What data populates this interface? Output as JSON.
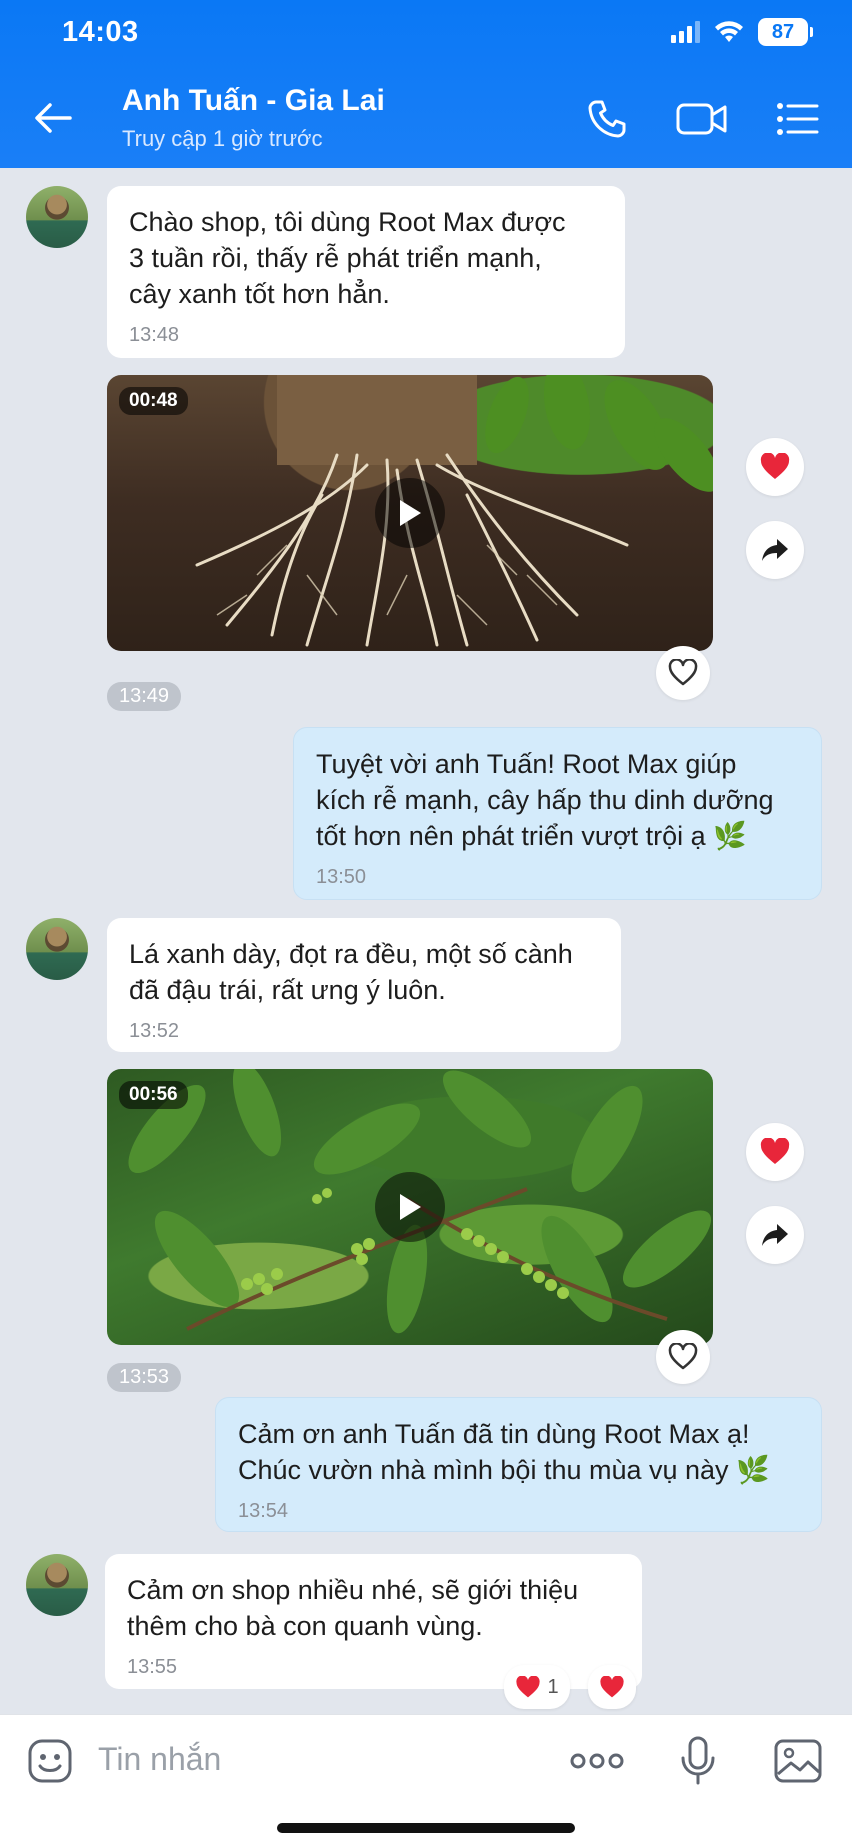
{
  "status_bar": {
    "time": "14:03",
    "battery": "87"
  },
  "header": {
    "name": "Anh Tuấn - Gia Lai",
    "status": "Truy cập 1 giờ trước"
  },
  "messages": [
    {
      "from": "them",
      "text": "Chào shop, tôi dùng Root Max được\n3 tuần rồi, thấy rễ phát triển mạnh,\ncây xanh tốt hơn hẳn.",
      "time": "13:48"
    },
    {
      "from": "them",
      "type": "video",
      "duration": "00:48",
      "time": "13:49",
      "scene": "coffee-roots"
    },
    {
      "from": "me",
      "text": "Tuyệt vời anh Tuấn! Root Max giúp\nkích rễ mạnh, cây hấp thu dinh dưỡng\ntốt hơn nên phát triển vượt trội ạ 🌿",
      "time": "13:50"
    },
    {
      "from": "them",
      "text": "Lá xanh dày, đọt ra đều, một số cành\nđã đậu trái, rất ưng ý luôn.",
      "time": "13:52"
    },
    {
      "from": "them",
      "type": "video",
      "duration": "00:56",
      "time": "13:53",
      "scene": "coffee-cherries"
    },
    {
      "from": "me",
      "text": "Cảm ơn anh Tuấn đã tin dùng Root Max ạ!\nChúc vườn nhà mình bội thu mùa vụ này 🌿",
      "time": "13:54"
    },
    {
      "from": "them",
      "text": "Cảm ơn shop nhiều nhé, sẽ giới thiệu\nthêm cho bà con quanh vùng.",
      "time": "13:55",
      "reaction_count": "1"
    }
  ],
  "input": {
    "placeholder": "Tin nhắn"
  },
  "colors": {
    "header": "#0a78f5",
    "my_bubble": "#d4ebfb",
    "heart": "#e8263a",
    "chat_bg": "#e2e6ed"
  }
}
